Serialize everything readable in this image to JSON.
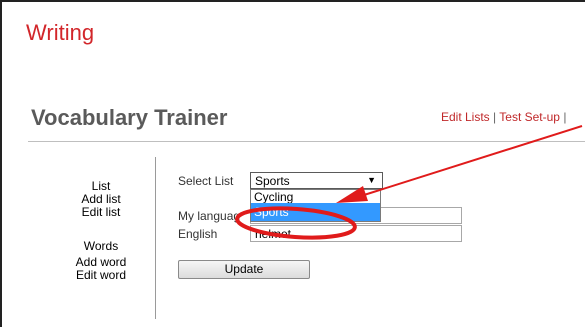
{
  "app": {
    "title": "Writing"
  },
  "page": {
    "heading": "Vocabulary Trainer"
  },
  "top_nav": {
    "edit_lists": "Edit Lists",
    "separator": "|",
    "test_setup": "Test Set-up",
    "trailing_separator": "|"
  },
  "sidebar": {
    "list_heading": "List",
    "add_list": "Add list",
    "edit_list": "Edit list",
    "words_heading": "Words",
    "add_word": "Add word",
    "edit_word": "Edit word"
  },
  "form": {
    "select_list_label": "Select List",
    "selected_list": "Sports",
    "dropdown_arrow": "▼",
    "dropdown_options": [
      "Cycling",
      "Sports"
    ],
    "my_language_label": "My languag",
    "english_label": "English",
    "english_value": "helmet",
    "update_label": "Update"
  },
  "colors": {
    "brand_red": "#d2262a",
    "link_red": "#c0282a",
    "selection_blue": "#3399ff",
    "annotation_red": "#e01b1b"
  }
}
